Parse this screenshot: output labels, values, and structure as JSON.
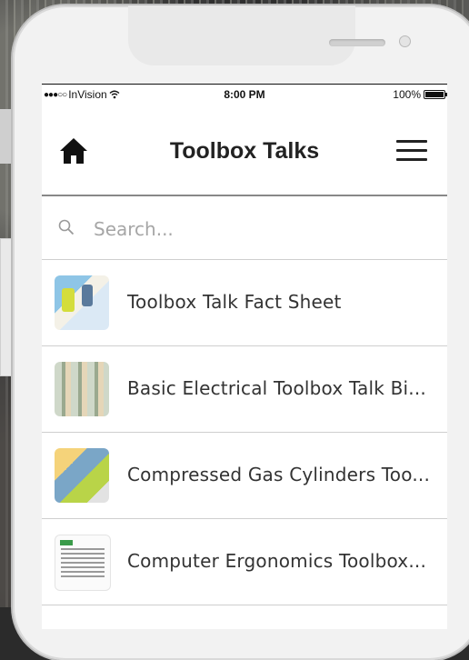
{
  "status_bar": {
    "carrier": "InVision",
    "time": "8:00 PM",
    "battery": "100%"
  },
  "nav": {
    "title": "Toolbox Talks",
    "home_icon": "home-icon",
    "menu_icon": "hamburger-menu-icon"
  },
  "search": {
    "placeholder": "Search..."
  },
  "list": {
    "items": [
      {
        "label": "Toolbox Talk Fact Sheet"
      },
      {
        "label": "Basic Electrical Toolbox Talk Bi..."
      },
      {
        "label": "Compressed Gas Cylinders Too..."
      },
      {
        "label": "Computer Ergonomics Toolbox..."
      }
    ]
  },
  "colors": {
    "text_primary": "#222222",
    "divider": "#cfcfcf",
    "placeholder": "#a6a6a6"
  }
}
